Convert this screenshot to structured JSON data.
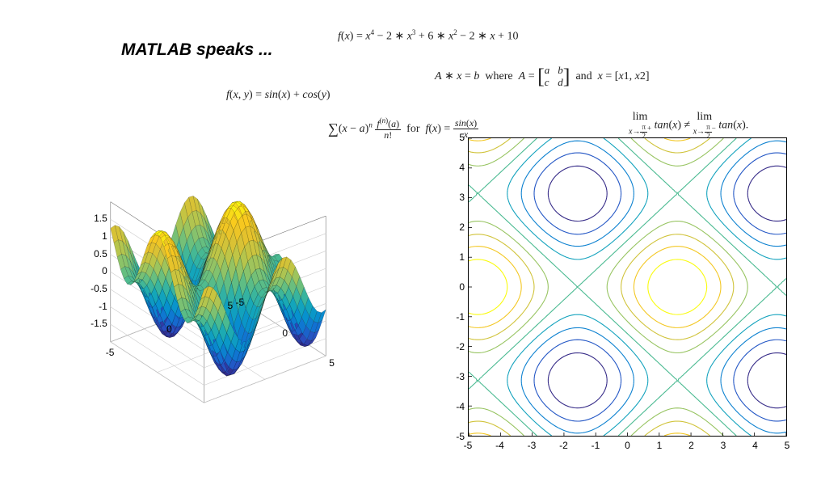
{
  "title": "MATLAB speaks ...",
  "equations": {
    "poly": {
      "text": "f(x) = x⁴ − 2 ∗ x³ + 6 ∗ x² − 2 ∗ x + 10"
    },
    "surface_fn": {
      "text": "f(x, y) = sin(x) + cos(y)"
    },
    "linear": {
      "pre": "A ∗ x = b  where  A =",
      "a": "a",
      "b": "b",
      "c": "c",
      "d": "d",
      "post": " and  x = [x1, x2]"
    },
    "taylor": {
      "sum_sym": "∑",
      "body1": "(x − a)",
      "sup_n": "n",
      "frac_num": "f⁽ⁿ⁾(a)",
      "frac_den": "n!",
      "mid": "  for  f(x) = ",
      "frac2_num": "sin(x)",
      "frac2_den": "x"
    },
    "limit": {
      "lim": "lim",
      "sub1": "x→π⁄2⁺",
      "tan": "tan(x)",
      "neq": " ≠ ",
      "sub2": "x→π⁄2⁻",
      "dot": "."
    }
  },
  "chart_data": [
    {
      "type": "surface",
      "title": "",
      "function": "sin(x)+cos(y)",
      "xlim": [
        -5,
        5
      ],
      "ylim": [
        -5,
        5
      ],
      "zlim": [
        -2,
        2
      ],
      "z_ticks": [
        -1.5,
        -1,
        -0.5,
        0,
        0.5,
        1,
        1.5
      ],
      "x_ticks": [
        -5,
        0,
        5
      ],
      "y_ticks": [
        -5,
        0,
        5
      ],
      "colormap": "parula"
    },
    {
      "type": "contour",
      "title": "",
      "function": "sin(x)+cos(y)",
      "xlim": [
        -5,
        5
      ],
      "ylim": [
        -5,
        5
      ],
      "x_ticks": [
        -5,
        -4,
        -3,
        -2,
        -1,
        0,
        1,
        2,
        3,
        4,
        5
      ],
      "y_ticks": [
        -5,
        -4,
        -3,
        -2,
        -1,
        0,
        1,
        2,
        3,
        4,
        5
      ],
      "levels": [
        -1.6,
        -1.2,
        -0.8,
        -0.4,
        0.0,
        0.4,
        0.8,
        1.2,
        1.6
      ],
      "colormap": "parula"
    }
  ]
}
